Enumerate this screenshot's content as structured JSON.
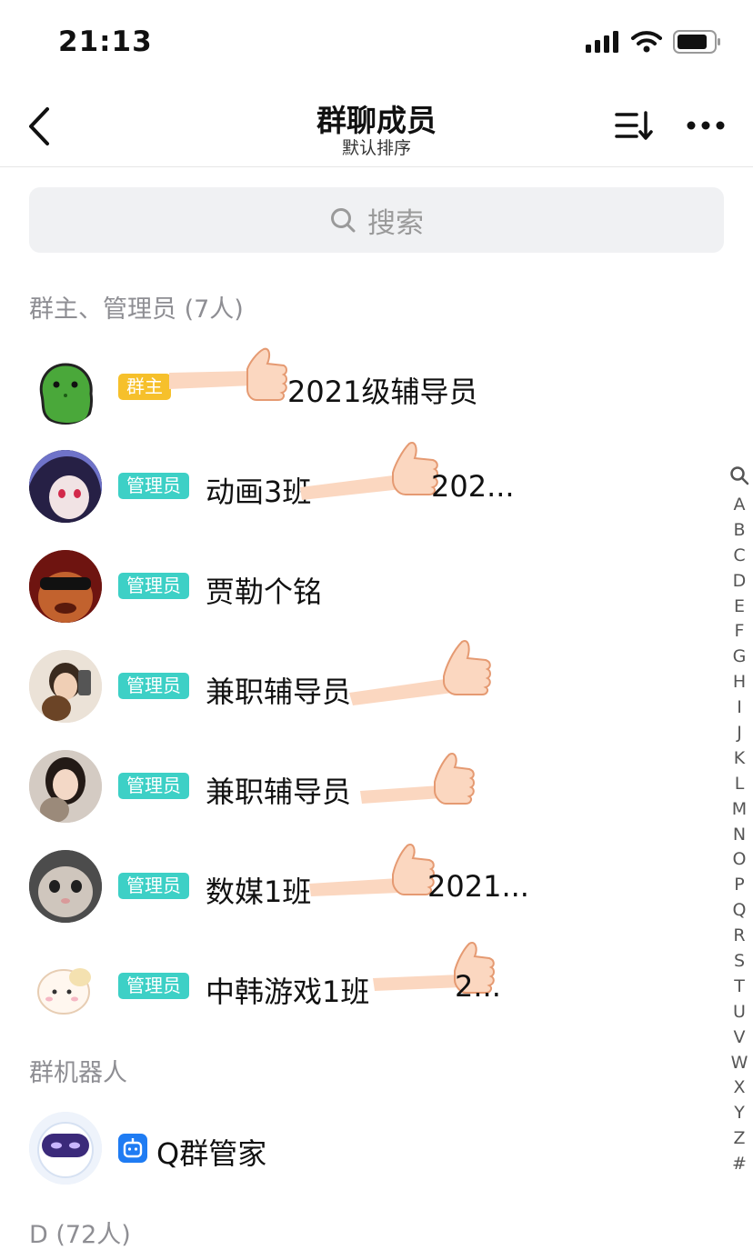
{
  "status_bar": {
    "time": "21:13"
  },
  "nav": {
    "title": "群聊成员",
    "subtitle": "默认排序"
  },
  "search": {
    "placeholder": "搜索"
  },
  "sections": {
    "admins_header": "群主、管理员 (7人)",
    "bots_header": "群机器人",
    "d_header": "D (72人)"
  },
  "members": [
    {
      "badge": "群主",
      "name_visible": "2021级辅导员"
    },
    {
      "badge": "管理员",
      "name_visible": "动画3班",
      "name_tail": "202..."
    },
    {
      "badge": "管理员",
      "name_visible": "贾勒个铭"
    },
    {
      "badge": "管理员",
      "name_visible": "兼职辅导员"
    },
    {
      "badge": "管理员",
      "name_visible": "兼职辅导员"
    },
    {
      "badge": "管理员",
      "name_visible": "数媒1班",
      "name_tail": "2021..."
    },
    {
      "badge": "管理员",
      "name_visible": "中韩游戏1班",
      "name_tail": "2..."
    }
  ],
  "bot": {
    "name": "Q群管家"
  },
  "alpha_index": [
    "A",
    "B",
    "C",
    "D",
    "E",
    "F",
    "G",
    "H",
    "I",
    "J",
    "K",
    "L",
    "M",
    "N",
    "O",
    "P",
    "Q",
    "R",
    "S",
    "T",
    "U",
    "V",
    "W",
    "X",
    "Y",
    "Z",
    "#"
  ],
  "colors": {
    "owner_badge": "#f6c02b",
    "admin_badge": "#3dd0c6",
    "bot_icon": "#1f7cf3"
  }
}
